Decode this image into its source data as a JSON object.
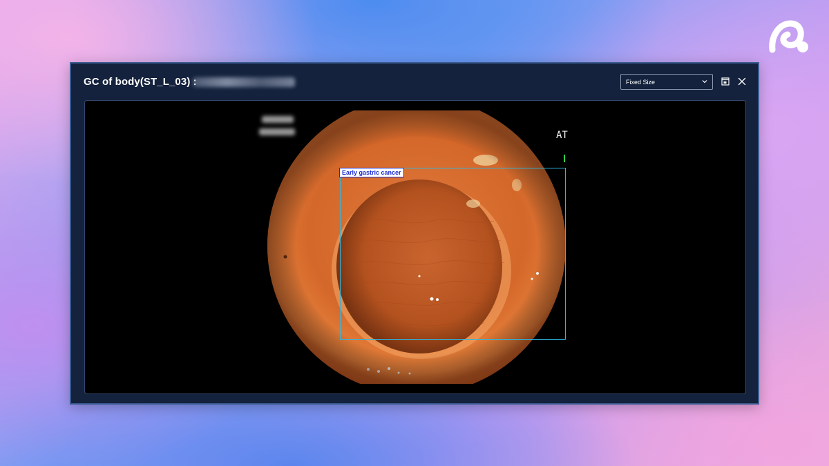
{
  "window": {
    "title": "GC of body(ST_L_03) :",
    "size_mode": "Fixed Size"
  },
  "viewer": {
    "overlay_text": "AT",
    "detection": {
      "label": "Early gastric cancer",
      "box_color": "#2bb9e6",
      "label_color": "#1a2bd1"
    }
  },
  "icons": {
    "brand": "brand-logo-icon",
    "dropdown": "chevron-down-icon",
    "restore": "restore-window-icon",
    "close": "close-icon"
  },
  "colors": {
    "window_bg": "#14223d",
    "window_border": "#3a5a8f",
    "viewer_bg": "#000000"
  }
}
